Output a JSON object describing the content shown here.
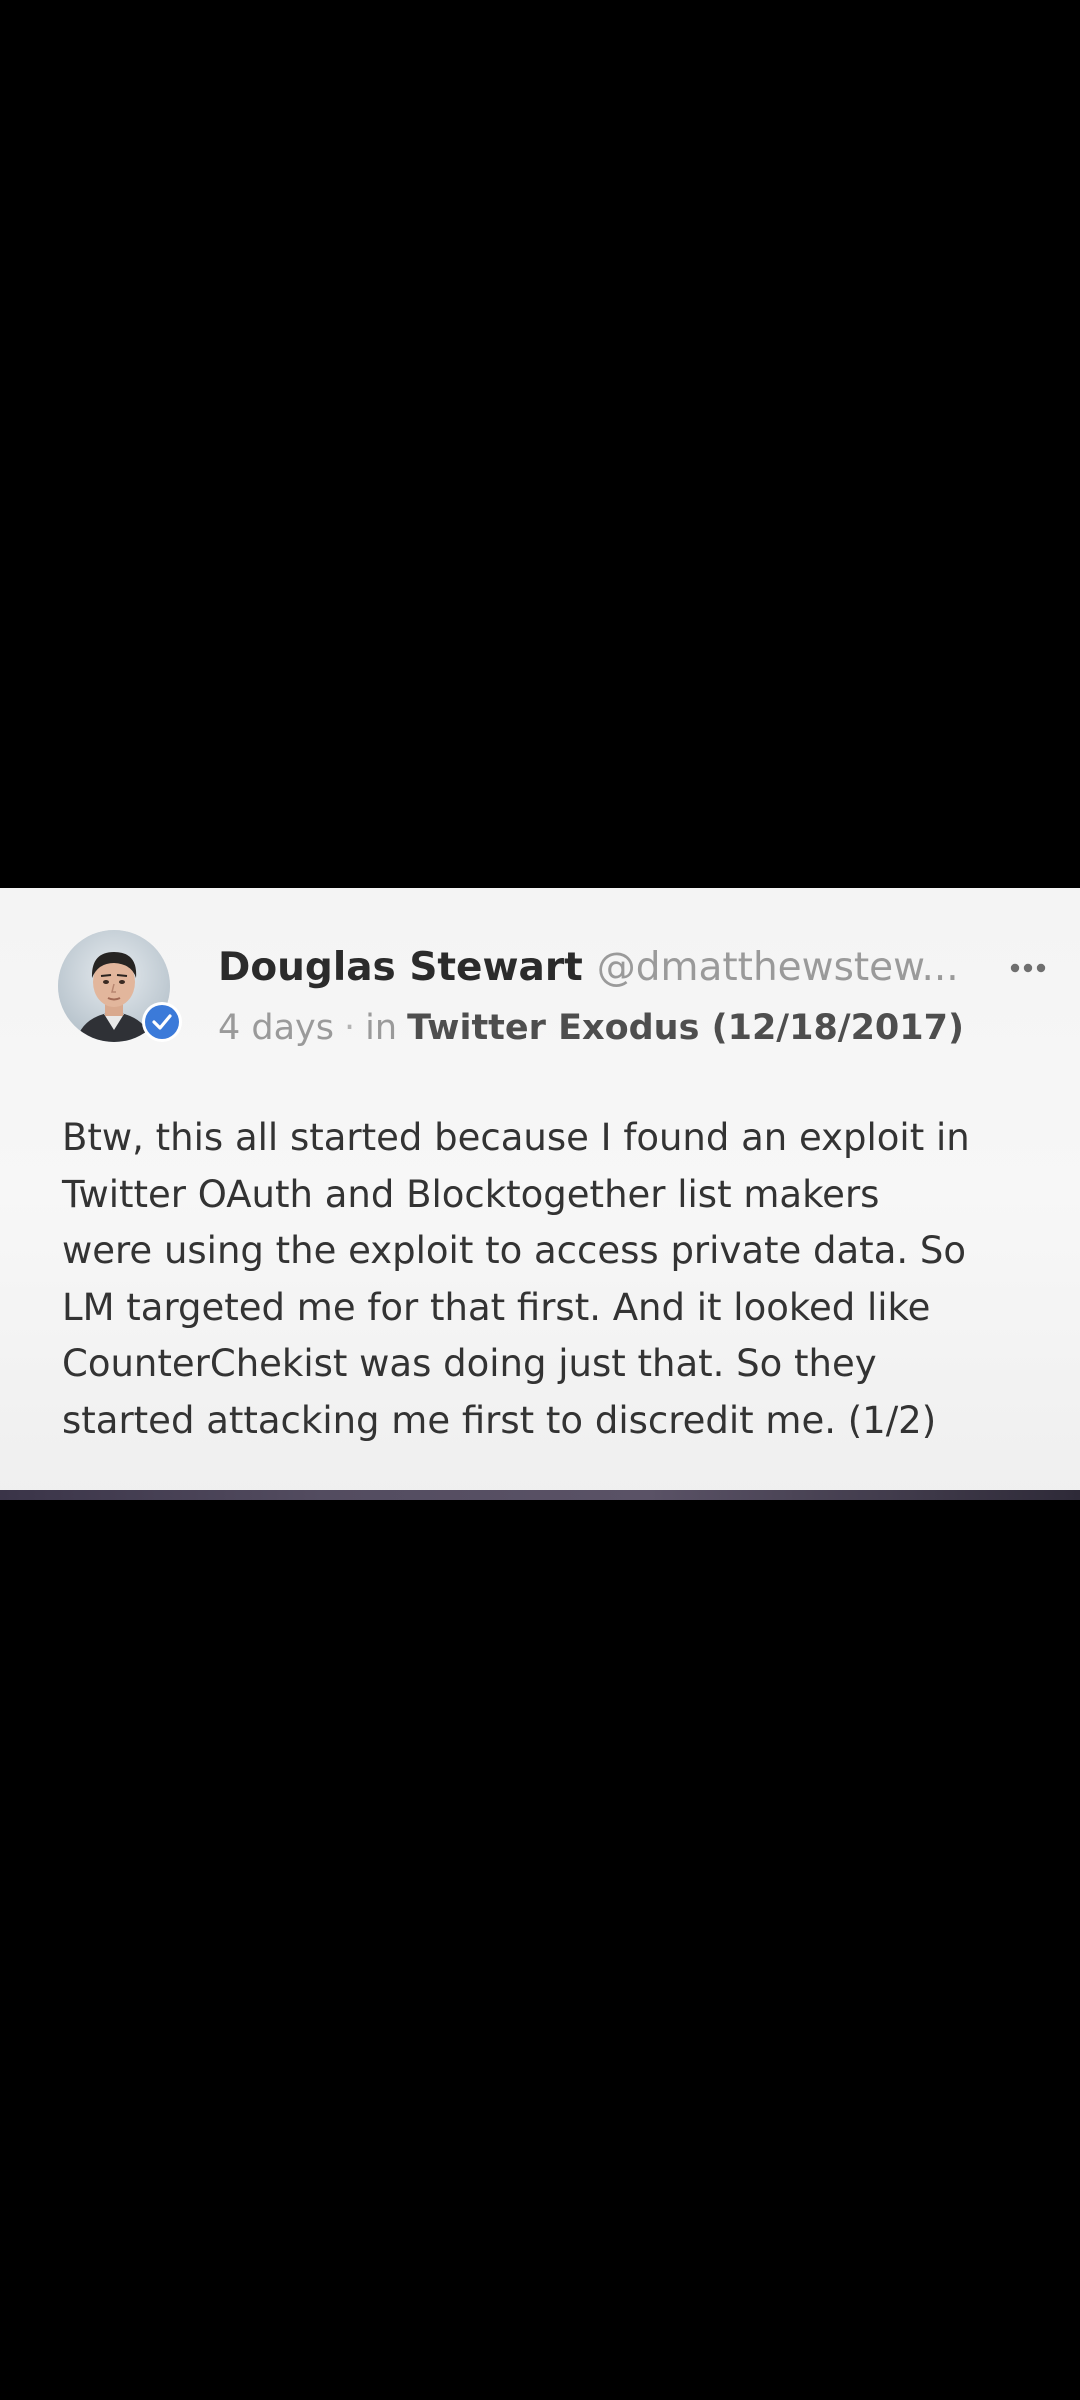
{
  "post": {
    "author_name": "Douglas Stewart",
    "author_handle": "@dmatthewstew...",
    "time": "4 days",
    "separator": "·",
    "in_label": "in",
    "group": "Twitter Exodus (12/18/2017)",
    "body_lines": [
      "Btw, this all started because I found an exploit in",
      "Twitter OAuth and Blocktogether list makers",
      "were using the exploit to access private data. So",
      "LM targeted me for that first. And it looked like",
      "CounterChekist was doing just that. So they",
      "started attacking me first to discredit me. (1/2)"
    ],
    "icons": {
      "avatar": "avatar-photo",
      "verified": "verified-check-icon",
      "more": "more-options-icon"
    }
  },
  "colors": {
    "background": "#000000",
    "card": "#f5f5f5",
    "name": "#2b2b2b",
    "muted": "#9a9a9a",
    "verified": "#3b7ad9"
  }
}
